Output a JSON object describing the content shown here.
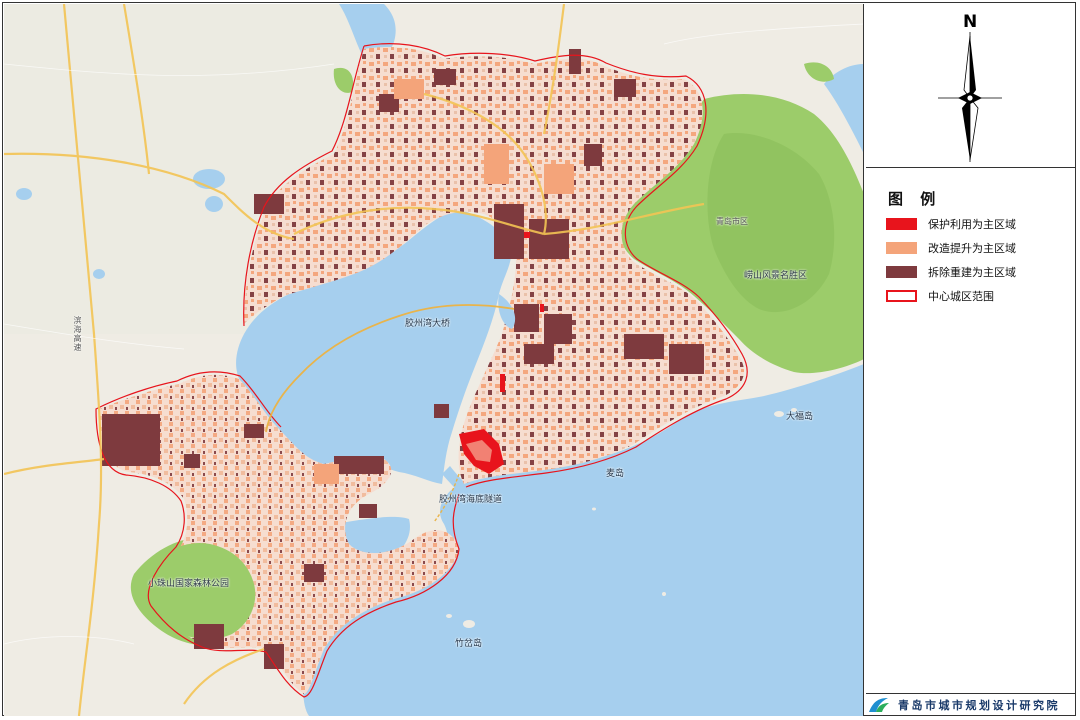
{
  "map": {
    "place_labels": [
      {
        "name": "label-jiaozhou-bay-bridge",
        "text": "胶州湾大桥",
        "cls": "sea"
      },
      {
        "name": "label-jiaozhou-bay-tunnel",
        "text": "胶州湾海底隧道",
        "cls": "sea"
      },
      {
        "name": "label-maidao",
        "text": "麦岛",
        "cls": "sea"
      },
      {
        "name": "label-dafudao",
        "text": "大福岛",
        "cls": "sea"
      },
      {
        "name": "label-zhuchadao",
        "text": "竹岔岛",
        "cls": "sea"
      },
      {
        "name": "label-laoshan",
        "text": "崂山风景名胜区",
        "cls": ""
      },
      {
        "name": "label-xiaozhushan",
        "text": "小珠山国家森林公园",
        "cls": ""
      },
      {
        "name": "label-binhai-expressway",
        "text": "滨海高速",
        "cls": "road v"
      },
      {
        "name": "label-north-area",
        "text": "青岛市区",
        "cls": "road"
      }
    ]
  },
  "compass": {
    "north_label": "N"
  },
  "legend": {
    "title": "图 例",
    "items": [
      {
        "label": "保护利用为主区域",
        "color": "#e8141c",
        "style": "fill"
      },
      {
        "label": "改造提升为主区域",
        "color": "#f4a47a",
        "style": "fill"
      },
      {
        "label": "拆除重建为主区域",
        "color": "#7e3a3e",
        "style": "fill"
      },
      {
        "label": "中心城区范围",
        "color": "#e8141c",
        "style": "outline"
      }
    ]
  },
  "footer": {
    "org_name": "青岛市城市规划设计研究院",
    "logo_icon": "planning-institute-logo-icon"
  },
  "colors": {
    "sea": "#a6cfee",
    "land": "#efece4",
    "mountain": "#9ccc6a",
    "urban": "#f6ddd0",
    "boundary": "#e8141c"
  }
}
